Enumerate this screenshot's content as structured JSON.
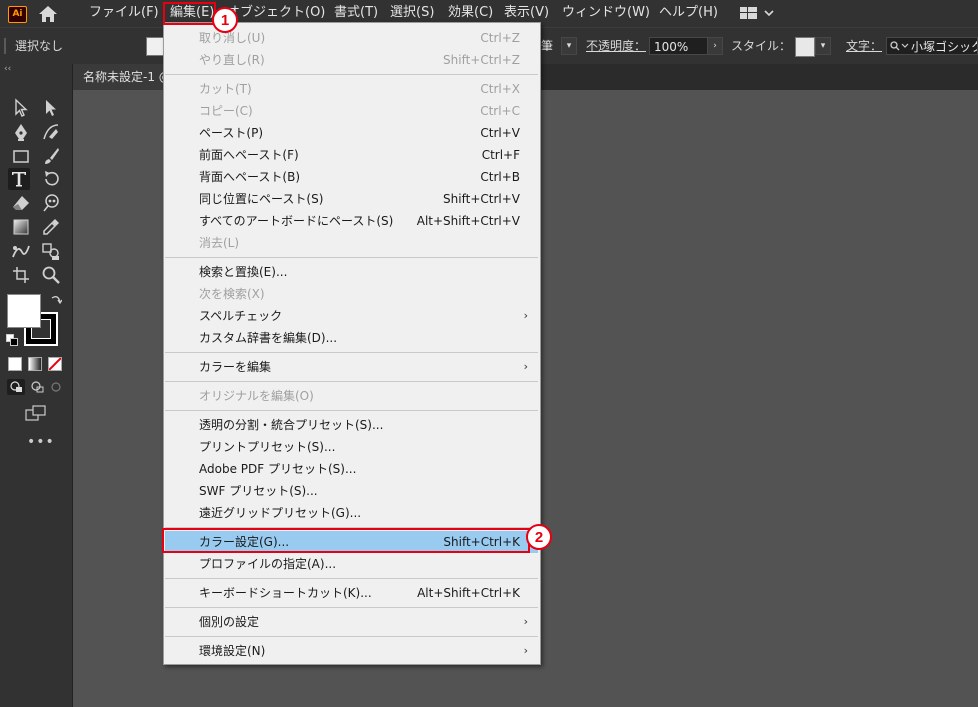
{
  "app": {
    "logo_text": "Ai",
    "accent": "#ff9a00"
  },
  "menubar": {
    "file": "ファイル(F)",
    "edit": "編集(E)",
    "object": "オブジェクト(O)",
    "type": "書式(T)",
    "select": "選択(S)",
    "effect": "効果(C)",
    "view": "表示(V)",
    "window": "ウィンドウ(W)",
    "help": "ヘルプ(H)"
  },
  "controlbar": {
    "selection": "選択なし",
    "brush_partial": "筆",
    "opacity_label": "不透明度：",
    "opacity_value": "100%",
    "style_label": "スタイル：",
    "char_label": "文字：",
    "font_value": "小塚ゴシック"
  },
  "document": {
    "tab_title": "名称未設定-1 @"
  },
  "annotations": {
    "step1": "1",
    "step2": "2",
    "highlight_color": "#e60012"
  },
  "edit_menu": {
    "undo": {
      "label": "取り消し(U)",
      "shortcut": "Ctrl+Z"
    },
    "redo": {
      "label": "やり直し(R)",
      "shortcut": "Shift+Ctrl+Z"
    },
    "cut": {
      "label": "カット(T)",
      "shortcut": "Ctrl+X"
    },
    "copy": {
      "label": "コピー(C)",
      "shortcut": "Ctrl+C"
    },
    "paste": {
      "label": "ペースト(P)",
      "shortcut": "Ctrl+V"
    },
    "paste_front": {
      "label": "前面へペースト(F)",
      "shortcut": "Ctrl+F"
    },
    "paste_back": {
      "label": "背面へペースト(B)",
      "shortcut": "Ctrl+B"
    },
    "paste_in_place": {
      "label": "同じ位置にペースト(S)",
      "shortcut": "Shift+Ctrl+V"
    },
    "paste_all_artboards": {
      "label": "すべてのアートボードにペースト(S)",
      "shortcut": "Alt+Shift+Ctrl+V"
    },
    "clear": {
      "label": "消去(L)"
    },
    "find_replace": {
      "label": "検索と置換(E)..."
    },
    "find_next": {
      "label": "次を検索(X)"
    },
    "spell_check": {
      "label": "スペルチェック"
    },
    "edit_dictionary": {
      "label": "カスタム辞書を編集(D)..."
    },
    "edit_colors": {
      "label": "カラーを編集"
    },
    "edit_original": {
      "label": "オリジナルを編集(O)"
    },
    "transparency_presets": {
      "label": "透明の分割・統合プリセット(S)..."
    },
    "print_presets": {
      "label": "プリントプリセット(S)..."
    },
    "pdf_presets": {
      "label": "Adobe PDF プリセット(S)..."
    },
    "swf_presets": {
      "label": "SWF プリセット(S)..."
    },
    "perspective_presets": {
      "label": "遠近グリッドプリセット(G)..."
    },
    "color_settings": {
      "label": "カラー設定(G)...",
      "shortcut": "Shift+Ctrl+K"
    },
    "assign_profile": {
      "label": "プロファイルの指定(A)..."
    },
    "keyboard_shortcuts": {
      "label": "キーボードショートカット(K)...",
      "shortcut": "Alt+Shift+Ctrl+K"
    },
    "preferences_individual": {
      "label": "個別の設定"
    },
    "preferences": {
      "label": "環境設定(N)"
    }
  }
}
